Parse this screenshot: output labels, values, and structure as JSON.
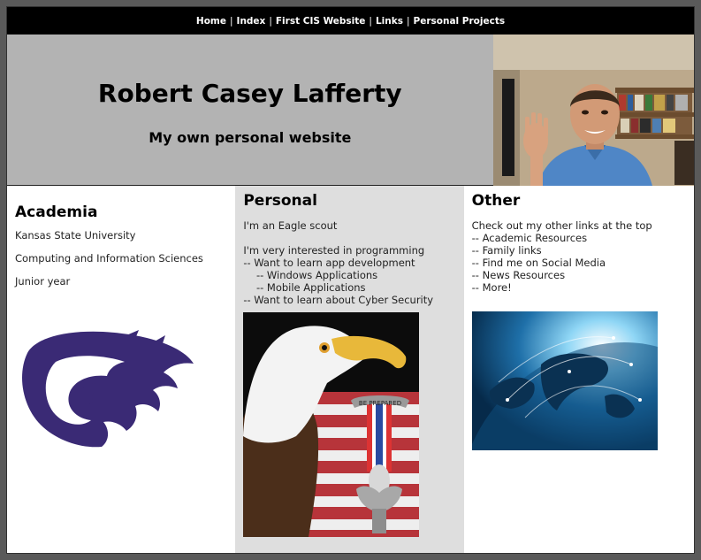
{
  "nav": {
    "items": [
      "Home",
      "Index",
      "First CIS Website",
      "Links",
      "Personal Projects"
    ],
    "separator": "|"
  },
  "header": {
    "title": "Robert Casey Lafferty",
    "subtitle": "My own personal website"
  },
  "academia": {
    "heading": "Academia",
    "items": [
      "Kansas State University",
      "Computing and Information Sciences",
      "Junior year"
    ],
    "logo_icon": "powercat-logo"
  },
  "personal": {
    "heading": "Personal",
    "scout": "I'm an Eagle scout",
    "lines": [
      "I'm very interested in programming",
      "-- Want to learn app development",
      "    -- Windows Applications",
      "    -- Mobile Applications",
      "-- Want to learn about Cyber Security"
    ],
    "medal_text": "BE PREPARED"
  },
  "other": {
    "heading": "Other",
    "lines": [
      "Check out my other links at the top",
      "-- Academic Resources",
      "-- Family links",
      "-- Find me on Social Media",
      "-- News Resources",
      "-- More!"
    ]
  },
  "colors": {
    "header_bg": "#b3b3b3",
    "nav_bg": "#000000",
    "personal_bg": "#dedede",
    "ksu_purple": "#3a2a75"
  }
}
